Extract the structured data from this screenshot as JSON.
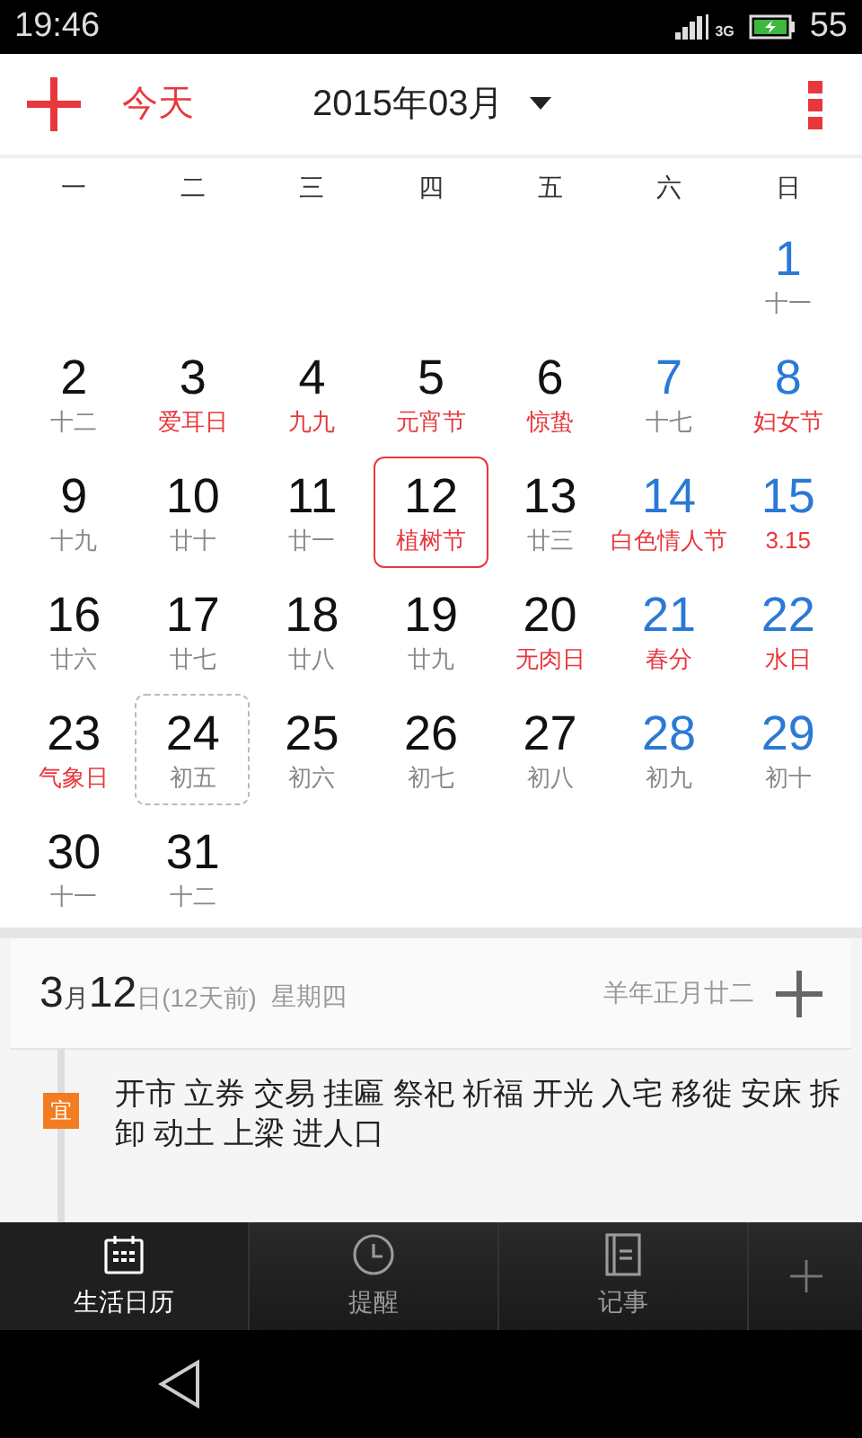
{
  "status_bar": {
    "time": "19:46",
    "network": "3G",
    "battery": "55"
  },
  "header": {
    "today_button": "今天",
    "month": "2015年03月"
  },
  "weekdays": [
    "一",
    "二",
    "三",
    "四",
    "五",
    "六",
    "日"
  ],
  "days": [
    {
      "kind": "empty"
    },
    {
      "kind": "empty"
    },
    {
      "kind": "empty"
    },
    {
      "kind": "empty"
    },
    {
      "kind": "empty"
    },
    {
      "kind": "empty"
    },
    {
      "kind": "day",
      "day": "1",
      "lunar": "十一",
      "weekend": true,
      "festival": false,
      "selected": false,
      "today": false
    },
    {
      "kind": "day",
      "day": "2",
      "lunar": "十二",
      "weekend": false,
      "festival": false,
      "selected": false,
      "today": false
    },
    {
      "kind": "day",
      "day": "3",
      "lunar": "爱耳日",
      "weekend": false,
      "festival": true,
      "selected": false,
      "today": false
    },
    {
      "kind": "day",
      "day": "4",
      "lunar": "九九",
      "weekend": false,
      "festival": true,
      "selected": false,
      "today": false
    },
    {
      "kind": "day",
      "day": "5",
      "lunar": "元宵节",
      "weekend": false,
      "festival": true,
      "selected": false,
      "today": false
    },
    {
      "kind": "day",
      "day": "6",
      "lunar": "惊蛰",
      "weekend": false,
      "festival": true,
      "selected": false,
      "today": false
    },
    {
      "kind": "day",
      "day": "7",
      "lunar": "十七",
      "weekend": true,
      "festival": false,
      "selected": false,
      "today": false
    },
    {
      "kind": "day",
      "day": "8",
      "lunar": "妇女节",
      "weekend": true,
      "festival": true,
      "selected": false,
      "today": false
    },
    {
      "kind": "day",
      "day": "9",
      "lunar": "十九",
      "weekend": false,
      "festival": false,
      "selected": false,
      "today": false
    },
    {
      "kind": "day",
      "day": "10",
      "lunar": "廿十",
      "weekend": false,
      "festival": false,
      "selected": false,
      "today": false
    },
    {
      "kind": "day",
      "day": "11",
      "lunar": "廿一",
      "weekend": false,
      "festival": false,
      "selected": false,
      "today": false
    },
    {
      "kind": "day",
      "day": "12",
      "lunar": "植树节",
      "weekend": false,
      "festival": true,
      "selected": true,
      "today": false
    },
    {
      "kind": "day",
      "day": "13",
      "lunar": "廿三",
      "weekend": false,
      "festival": false,
      "selected": false,
      "today": false
    },
    {
      "kind": "day",
      "day": "14",
      "lunar": "白色情人节",
      "weekend": true,
      "festival": true,
      "selected": false,
      "today": false
    },
    {
      "kind": "day",
      "day": "15",
      "lunar": "3.15",
      "weekend": true,
      "festival": true,
      "selected": false,
      "today": false
    },
    {
      "kind": "day",
      "day": "16",
      "lunar": "廿六",
      "weekend": false,
      "festival": false,
      "selected": false,
      "today": false
    },
    {
      "kind": "day",
      "day": "17",
      "lunar": "廿七",
      "weekend": false,
      "festival": false,
      "selected": false,
      "today": false
    },
    {
      "kind": "day",
      "day": "18",
      "lunar": "廿八",
      "weekend": false,
      "festival": false,
      "selected": false,
      "today": false
    },
    {
      "kind": "day",
      "day": "19",
      "lunar": "廿九",
      "weekend": false,
      "festival": false,
      "selected": false,
      "today": false
    },
    {
      "kind": "day",
      "day": "20",
      "lunar": "无肉日",
      "weekend": false,
      "festival": true,
      "selected": false,
      "today": false
    },
    {
      "kind": "day",
      "day": "21",
      "lunar": "春分",
      "weekend": true,
      "festival": true,
      "selected": false,
      "today": false
    },
    {
      "kind": "day",
      "day": "22",
      "lunar": "水日",
      "weekend": true,
      "festival": true,
      "selected": false,
      "today": false
    },
    {
      "kind": "day",
      "day": "23",
      "lunar": "气象日",
      "weekend": false,
      "festival": true,
      "selected": false,
      "today": false
    },
    {
      "kind": "day",
      "day": "24",
      "lunar": "初五",
      "weekend": false,
      "festival": false,
      "selected": false,
      "today": true
    },
    {
      "kind": "day",
      "day": "25",
      "lunar": "初六",
      "weekend": false,
      "festival": false,
      "selected": false,
      "today": false
    },
    {
      "kind": "day",
      "day": "26",
      "lunar": "初七",
      "weekend": false,
      "festival": false,
      "selected": false,
      "today": false
    },
    {
      "kind": "day",
      "day": "27",
      "lunar": "初八",
      "weekend": false,
      "festival": false,
      "selected": false,
      "today": false
    },
    {
      "kind": "day",
      "day": "28",
      "lunar": "初九",
      "weekend": true,
      "festival": false,
      "selected": false,
      "today": false
    },
    {
      "kind": "day",
      "day": "29",
      "lunar": "初十",
      "weekend": true,
      "festival": false,
      "selected": false,
      "today": false
    },
    {
      "kind": "day",
      "day": "30",
      "lunar": "十一",
      "weekend": false,
      "festival": false,
      "selected": false,
      "today": false
    },
    {
      "kind": "day",
      "day": "31",
      "lunar": "十二",
      "weekend": false,
      "festival": false,
      "selected": false,
      "today": false
    }
  ],
  "detail": {
    "date_parts": [
      {
        "text": "3",
        "kind": "big"
      },
      {
        "text": "月",
        "kind": "small"
      },
      {
        "text": "12",
        "kind": "big"
      },
      {
        "text": "日(12天前)",
        "kind": "note"
      }
    ],
    "weekday": "星期四",
    "lunar_date": "羊年正月廿二",
    "almanac": [
      {
        "badge": "宜",
        "color": "#f47c20",
        "text": "开市 立券 交易 挂匾 祭祀 祈福 开光 入宅 移徙 安床 拆卸 动土 上梁 进人口"
      }
    ]
  },
  "tabs": [
    {
      "label": "生活日历",
      "selected": true,
      "kind": "calendar"
    },
    {
      "label": "提醒",
      "selected": false,
      "kind": "clock"
    },
    {
      "label": "记事",
      "selected": false,
      "kind": "notebook"
    }
  ]
}
